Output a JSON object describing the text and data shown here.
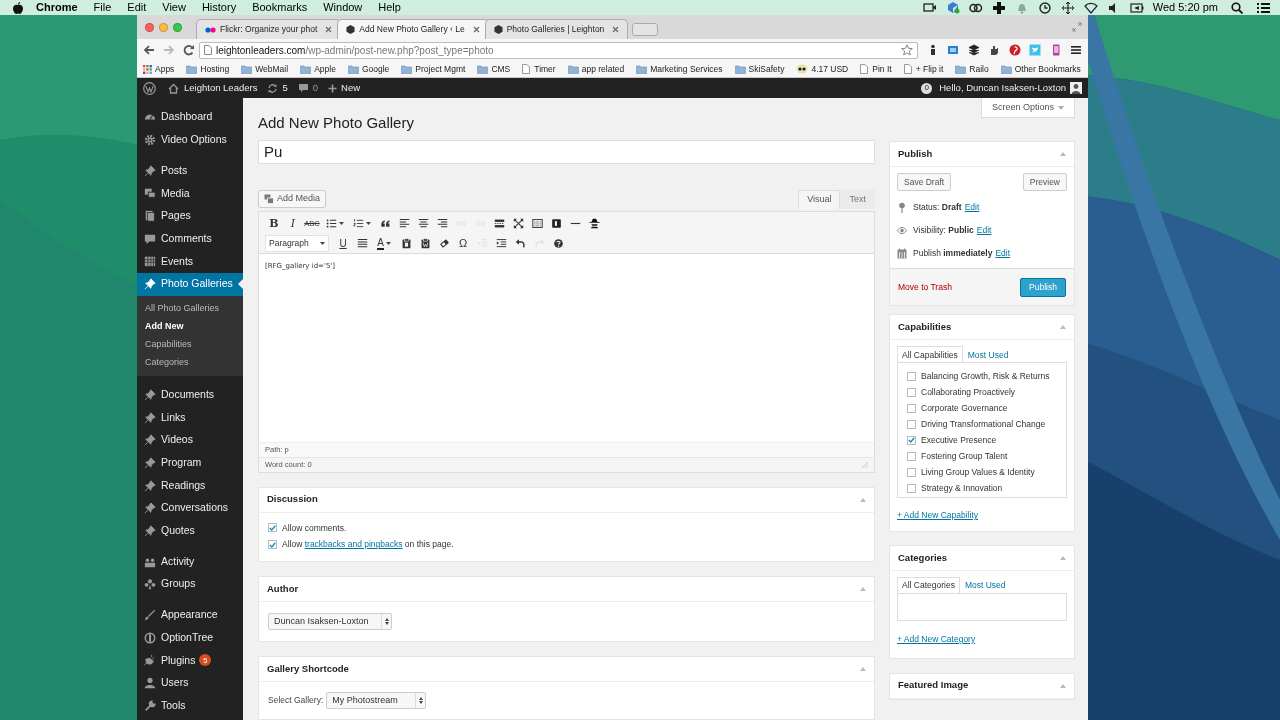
{
  "menubar": {
    "app": "Chrome",
    "menus": [
      "File",
      "Edit",
      "View",
      "History",
      "Bookmarks",
      "Window",
      "Help"
    ],
    "clock": "Wed 5:20 pm"
  },
  "browser": {
    "tabs": [
      {
        "title": "Flickr: Organize your phot",
        "selected": false
      },
      {
        "title": "Add New Photo Gallery ‹ Le",
        "selected": true
      },
      {
        "title": "Photo Galleries | Leighton",
        "selected": false
      }
    ],
    "url_host": "leightonleaders.com",
    "url_path": "/wp-admin/post-new.php?post_type=photo",
    "bookmarks": [
      {
        "label": "Apps",
        "kind": "apps"
      },
      {
        "label": "Hosting",
        "kind": "folder"
      },
      {
        "label": "WebMail",
        "kind": "folder"
      },
      {
        "label": "Apple",
        "kind": "folder"
      },
      {
        "label": "Google",
        "kind": "folder"
      },
      {
        "label": "Project Mgmt",
        "kind": "folder"
      },
      {
        "label": "CMS",
        "kind": "folder"
      },
      {
        "label": "Timer",
        "kind": "page"
      },
      {
        "label": "app related",
        "kind": "folder"
      },
      {
        "label": "Marketing Services",
        "kind": "folder"
      },
      {
        "label": "SkiSafety",
        "kind": "folder"
      },
      {
        "label": "4.17 USD",
        "kind": "currency"
      },
      {
        "label": "Pin It",
        "kind": "page"
      },
      {
        "label": "+ Flip it",
        "kind": "page"
      },
      {
        "label": "Railo",
        "kind": "folder"
      }
    ],
    "other_bookmarks": "Other Bookmarks"
  },
  "admin_bar": {
    "site": "Leighton Leaders",
    "updates": "5",
    "comments": "0",
    "new": "New",
    "notifications": "0",
    "greeting": "Hello, Duncan Isaksen-Loxton"
  },
  "sidebar": {
    "groups": [
      [
        {
          "label": "Dashboard",
          "selected": false
        },
        {
          "label": "Video Options",
          "selected": false
        }
      ],
      [
        {
          "label": "Posts",
          "selected": false
        },
        {
          "label": "Media",
          "selected": false
        },
        {
          "label": "Pages",
          "selected": false
        },
        {
          "label": "Comments",
          "selected": false
        },
        {
          "label": "Events",
          "selected": false
        },
        {
          "label": "Photo Galleries",
          "selected": true,
          "children": [
            {
              "label": "All Photo Galleries",
              "selected": false
            },
            {
              "label": "Add New",
              "selected": true
            },
            {
              "label": "Capabilities",
              "selected": false
            },
            {
              "label": "Categories",
              "selected": false
            }
          ]
        }
      ],
      [
        {
          "label": "Documents",
          "selected": false
        },
        {
          "label": "Links",
          "selected": false
        },
        {
          "label": "Videos",
          "selected": false
        },
        {
          "label": "Program",
          "selected": false
        },
        {
          "label": "Readings",
          "selected": false
        },
        {
          "label": "Conversations",
          "selected": false
        },
        {
          "label": "Quotes",
          "selected": false
        }
      ],
      [
        {
          "label": "Activity",
          "selected": false
        },
        {
          "label": "Groups",
          "selected": false
        }
      ],
      [
        {
          "label": "Appearance",
          "selected": false
        },
        {
          "label": "OptionTree",
          "selected": false
        },
        {
          "label": "Plugins",
          "selected": false,
          "badge": "5"
        },
        {
          "label": "Users",
          "selected": false
        },
        {
          "label": "Tools",
          "selected": false
        }
      ]
    ]
  },
  "page_title": "Add New Photo Gallery",
  "screen_options": "Screen Options",
  "title_field": {
    "value": "Pu"
  },
  "add_media": "Add Media",
  "editor": {
    "tabs": [
      {
        "label": "Visual",
        "selected": true
      },
      {
        "label": "Text",
        "selected": false
      }
    ],
    "toolbar": [
      [
        {
          "kind": "bold",
          "text": "B",
          "disabled": false
        },
        {
          "kind": "italic",
          "text": "I",
          "disabled": false
        },
        {
          "kind": "strike",
          "text": "ABC",
          "disabled": false
        },
        {
          "kind": "bullets",
          "disabled": false
        },
        {
          "kind": "numbers",
          "disabled": false
        },
        {
          "kind": "quote",
          "disabled": false
        },
        {
          "kind": "align-left",
          "disabled": false
        },
        {
          "kind": "align-center",
          "disabled": false
        },
        {
          "kind": "align-right",
          "disabled": false
        },
        {
          "kind": "link",
          "disabled": true
        },
        {
          "kind": "unlink",
          "disabled": true
        },
        {
          "kind": "more",
          "disabled": false
        },
        {
          "kind": "fullscreen",
          "disabled": false
        },
        {
          "kind": "kitchen",
          "disabled": false
        },
        {
          "kind": "square",
          "disabled": false
        },
        {
          "kind": "rule",
          "disabled": false
        },
        {
          "kind": "spy",
          "disabled": false
        }
      ],
      [
        {
          "kind": "format",
          "text": "Paragraph",
          "disabled": false
        },
        {
          "kind": "underline",
          "text": "U",
          "disabled": false
        },
        {
          "kind": "justify",
          "disabled": false
        },
        {
          "kind": "color",
          "text": "A",
          "disabled": false
        },
        {
          "kind": "paste-text",
          "disabled": false
        },
        {
          "kind": "paste-word",
          "disabled": false
        },
        {
          "kind": "eraser",
          "disabled": false
        },
        {
          "kind": "symbol",
          "text": "Ω",
          "disabled": false
        },
        {
          "kind": "outdent",
          "disabled": true
        },
        {
          "kind": "indent",
          "disabled": false
        },
        {
          "kind": "undo",
          "disabled": false
        },
        {
          "kind": "redo",
          "disabled": true
        },
        {
          "kind": "help",
          "disabled": false
        }
      ]
    ],
    "content": "[RFG_gallery id='5']",
    "path": "Path: p",
    "word_count": "Word count: 0"
  },
  "discussion": {
    "title": "Discussion",
    "options": [
      {
        "before": "Allow comments.",
        "checked": true
      },
      {
        "before": "Allow",
        "link": "trackbacks and pingbacks",
        "after": "on this page.",
        "checked": true
      }
    ]
  },
  "author": {
    "title": "Author",
    "value": "Duncan Isaksen-Loxton"
  },
  "gallery_shortcode": {
    "title": "Gallery Shortcode",
    "label": "Select Gallery:",
    "value": "My Photostream"
  },
  "publish": {
    "title": "Publish",
    "save_draft": "Save Draft",
    "preview": "Preview",
    "rows": [
      {
        "kind": "status",
        "text": "Status: **Draft**",
        "link": "Edit"
      },
      {
        "kind": "visibility",
        "text": "Visibility: **Public**",
        "link": "Edit"
      },
      {
        "kind": "schedule",
        "text": "Publish **immediately**",
        "link": "Edit"
      }
    ],
    "trash": "Move to Trash",
    "publish": "Publish"
  },
  "capabilities": {
    "title": "Capabilities",
    "tabs": [
      {
        "label": "All Capabilities",
        "selected": true
      },
      {
        "label": "Most Used",
        "selected": false
      }
    ],
    "items": [
      {
        "label": "Balancing Growth, Risk & Returns",
        "checked": false
      },
      {
        "label": "Collaborating Proactively",
        "checked": false
      },
      {
        "label": "Corporate Governance",
        "checked": false
      },
      {
        "label": "Driving Transformational Change",
        "checked": false
      },
      {
        "label": "Executive Presence",
        "checked": true
      },
      {
        "label": "Fostering Group Talent",
        "checked": false
      },
      {
        "label": "Living Group Values & Identity",
        "checked": false
      },
      {
        "label": "Strategy & Innovation",
        "checked": false
      }
    ],
    "add_link": "+ Add New Capability"
  },
  "categories": {
    "title": "Categories",
    "tabs": [
      {
        "label": "All Categories",
        "selected": true
      },
      {
        "label": "Most Used",
        "selected": false
      }
    ],
    "add_link": "+ Add New Category"
  },
  "featured_image": {
    "title": "Featured Image"
  }
}
